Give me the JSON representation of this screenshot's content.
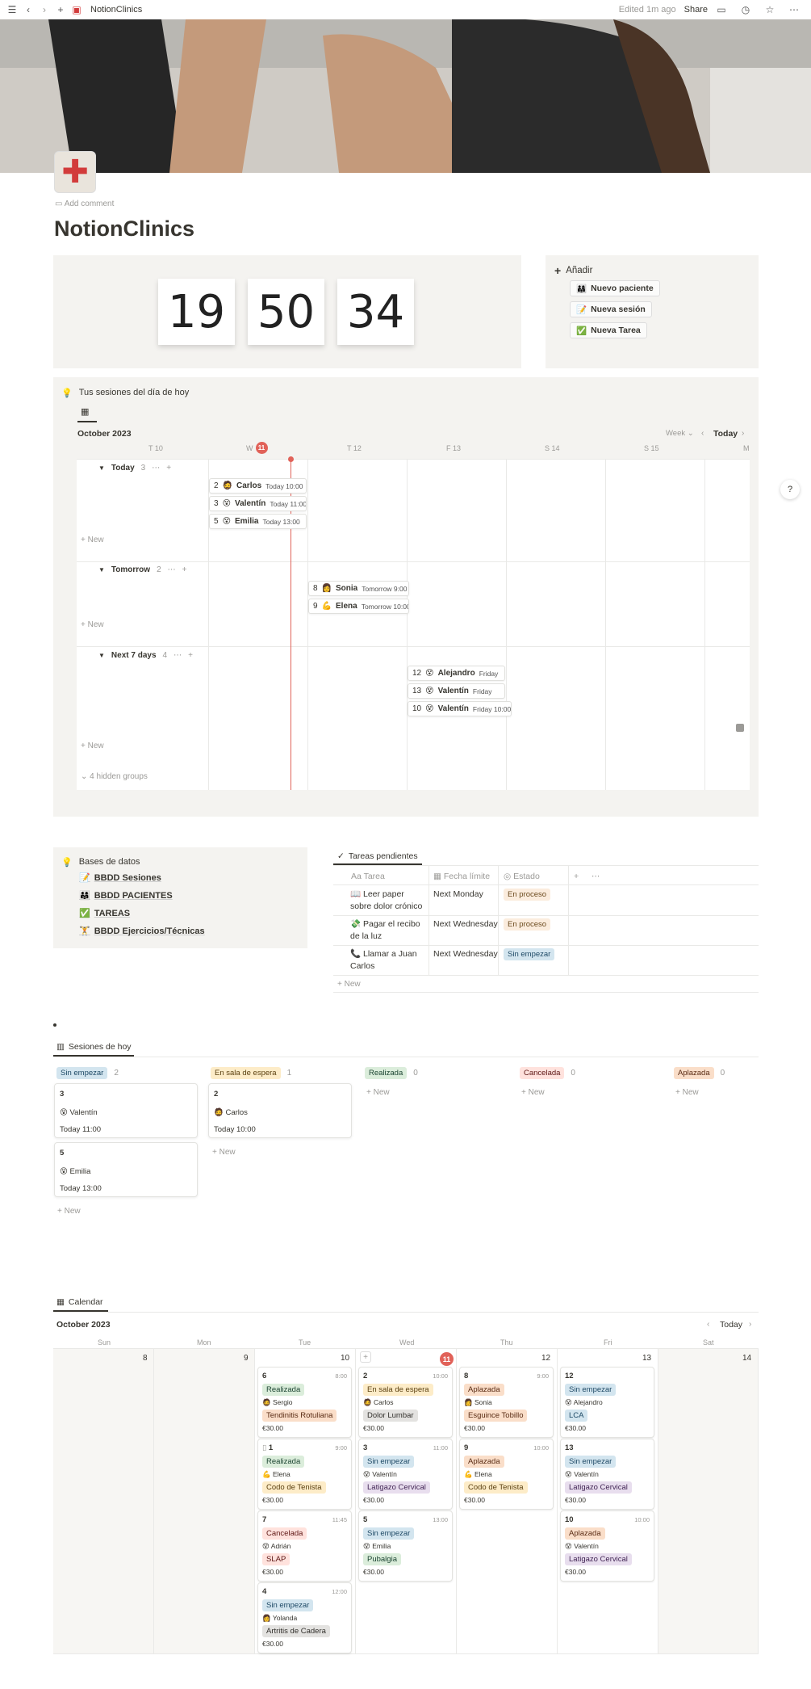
{
  "topbar": {
    "title": "NotionClinics",
    "edited": "Edited 1m ago",
    "share": "Share"
  },
  "page": {
    "add_comment": "Add comment",
    "title": "NotionClinics"
  },
  "clock": {
    "hours": "19",
    "minutes": "50",
    "seconds": "34"
  },
  "add_panel": {
    "label": "Añadir",
    "buttons": [
      {
        "emoji": "👨‍👩‍👧",
        "label": "Nuevo paciente"
      },
      {
        "emoji": "📝",
        "label": "Nueva sesión"
      },
      {
        "emoji": "✅",
        "label": "Nueva Tarea"
      }
    ]
  },
  "sessions": {
    "callout": "Tus sesiones del día de hoy",
    "month": "October 2023",
    "view": "Week",
    "today_btn": "Today",
    "days": [
      "T 10",
      "W",
      "T 12",
      "F 13",
      "S 14",
      "S 15",
      "M"
    ],
    "today_num": "11",
    "groups": [
      {
        "name": "Today",
        "count": "3"
      },
      {
        "name": "Tomorrow",
        "count": "2"
      },
      {
        "name": "Next 7 days",
        "count": "4"
      }
    ],
    "new_label": "New",
    "hidden_groups": "4 hidden groups",
    "events": [
      {
        "num": "2",
        "name": "Carlos",
        "time": "Today 10:00"
      },
      {
        "num": "3",
        "name": "Valentín",
        "time": "Today 11:00"
      },
      {
        "num": "5",
        "name": "Emilia",
        "time": "Today 13:00"
      },
      {
        "num": "8",
        "name": "Sonia",
        "time": "Tomorrow 9:00"
      },
      {
        "num": "9",
        "name": "Elena",
        "time": "Tomorrow 10:00"
      },
      {
        "num": "12",
        "name": "Alejandro",
        "time": "Friday"
      },
      {
        "num": "13",
        "name": "Valentín",
        "time": "Friday"
      },
      {
        "num": "10",
        "name": "Valentín",
        "time": "Friday 10:00"
      }
    ]
  },
  "databases": {
    "callout": "Bases de datos",
    "items": [
      {
        "emoji": "📝",
        "label": "BBDD Sesiones"
      },
      {
        "emoji": "👨‍👩‍👧",
        "label": "BBDD PACIENTES"
      },
      {
        "emoji": "✅",
        "label": "TAREAS"
      },
      {
        "emoji": "🏋️",
        "label": "BBDD Ejercicios/Técnicas"
      }
    ]
  },
  "tasks": {
    "tab": "Tareas pendientes",
    "cols": [
      "Tarea",
      "Fecha límite",
      "Estado"
    ],
    "rows": [
      {
        "emoji": "📖",
        "task": "Leer paper sobre dolor crónico",
        "date": "Next Monday",
        "status": "En proceso"
      },
      {
        "emoji": "💸",
        "task": "Pagar el recibo de la luz",
        "date": "Next Wednesday",
        "status": "En proceso"
      },
      {
        "emoji": "📞",
        "task": "Llamar a Juan Carlos",
        "date": "Next Wednesday",
        "status": "Sin empezar"
      }
    ],
    "new_label": "New"
  },
  "board": {
    "tab": "Sesiones de hoy",
    "columns": [
      {
        "name": "Sin empezar",
        "count": "2"
      },
      {
        "name": "En sala de espera",
        "count": "1"
      },
      {
        "name": "Realizada",
        "count": "0"
      },
      {
        "name": "Cancelada",
        "count": "0"
      },
      {
        "name": "Aplazada",
        "count": "0"
      }
    ],
    "cards": [
      {
        "num": "3",
        "name": "Valentín",
        "time": "Today 11:00"
      },
      {
        "num": "5",
        "name": "Emilia",
        "time": "Today 13:00"
      },
      {
        "num": "2",
        "name": "Carlos",
        "time": "Today 10:00"
      }
    ],
    "new_label": "New"
  },
  "calendar": {
    "tab": "Calendar",
    "month": "October 2023",
    "today_btn": "Today",
    "weekdays": [
      "Sun",
      "Mon",
      "Tue",
      "Wed",
      "Thu",
      "Fri",
      "Sat"
    ],
    "dates": [
      "8",
      "9",
      "10",
      "11",
      "12",
      "13",
      "14"
    ],
    "tue": [
      {
        "num": "6",
        "time": "8:00",
        "status": "Realizada",
        "patient": "Sergio",
        "dx": "Tendinitis Rotuliana",
        "price": "€30.00"
      },
      {
        "num": "1",
        "time": "9:00",
        "status": "Realizada",
        "patient": "Elena",
        "dx": "Codo de Tenista",
        "price": "€30.00"
      },
      {
        "num": "7",
        "time": "11:45",
        "status": "Cancelada",
        "patient": "Adrián",
        "dx": "SLAP",
        "price": "€30.00"
      },
      {
        "num": "4",
        "time": "12:00",
        "status": "Sin empezar",
        "patient": "Yolanda",
        "dx": "Artritis de Cadera",
        "price": "€30.00"
      }
    ],
    "wed": [
      {
        "num": "2",
        "time": "10:00",
        "status": "En sala de espera",
        "patient": "Carlos",
        "dx": "Dolor Lumbar",
        "price": "€30.00"
      },
      {
        "num": "3",
        "time": "11:00",
        "status": "Sin empezar",
        "patient": "Valentín",
        "dx": "Latigazo Cervical",
        "price": "€30.00"
      },
      {
        "num": "5",
        "time": "13:00",
        "status": "Sin empezar",
        "patient": "Emilia",
        "dx": "Pubalgia",
        "price": "€30.00"
      }
    ],
    "thu": [
      {
        "num": "8",
        "time": "9:00",
        "status": "Aplazada",
        "patient": "Sonia",
        "dx": "Esguince Tobillo",
        "price": "€30.00"
      },
      {
        "num": "9",
        "time": "10:00",
        "status": "Aplazada",
        "patient": "Elena",
        "dx": "Codo de Tenista",
        "price": "€30.00"
      }
    ],
    "fri": [
      {
        "num": "12",
        "time": "",
        "status": "Sin empezar",
        "patient": "Alejandro",
        "dx": "LCA",
        "price": "€30.00"
      },
      {
        "num": "13",
        "time": "",
        "status": "Sin empezar",
        "patient": "Valentín",
        "dx": "Latigazo Cervical",
        "price": "€30.00"
      },
      {
        "num": "10",
        "time": "10:00",
        "status": "Aplazada",
        "patient": "Valentín",
        "dx": "Latigazo Cervical",
        "price": "€30.00"
      }
    ]
  }
}
